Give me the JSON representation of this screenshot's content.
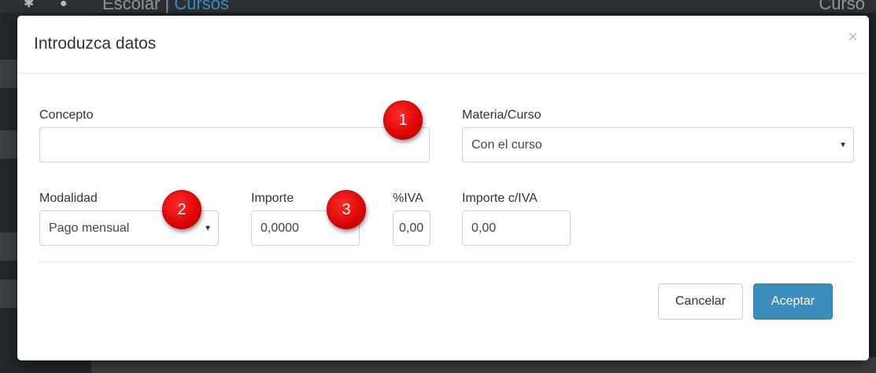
{
  "background": {
    "app_title": "Escolar |",
    "app_title_link": "Cursos",
    "right_text": "Curso",
    "icons": [
      "gear-icon",
      "info-icon"
    ]
  },
  "modal": {
    "title": "Introduzca datos",
    "close_symbol": "×"
  },
  "form": {
    "concepto": {
      "label": "Concepto",
      "value": ""
    },
    "materia_curso": {
      "label": "Materia/Curso",
      "selected": "Con el curso"
    },
    "modalidad": {
      "label": "Modalidad",
      "selected": "Pago mensual"
    },
    "importe": {
      "label": "Importe",
      "value": "0,0000"
    },
    "iva": {
      "label": "%IVA",
      "value": "0,00"
    },
    "importe_iva": {
      "label": "Importe c/IVA",
      "value": "0,00"
    }
  },
  "badges": [
    "1",
    "2",
    "3"
  ],
  "buttons": {
    "cancel": "Cancelar",
    "accept": "Aceptar"
  },
  "colors": {
    "primary": "#3c8dbc",
    "badge": "#e00000"
  }
}
